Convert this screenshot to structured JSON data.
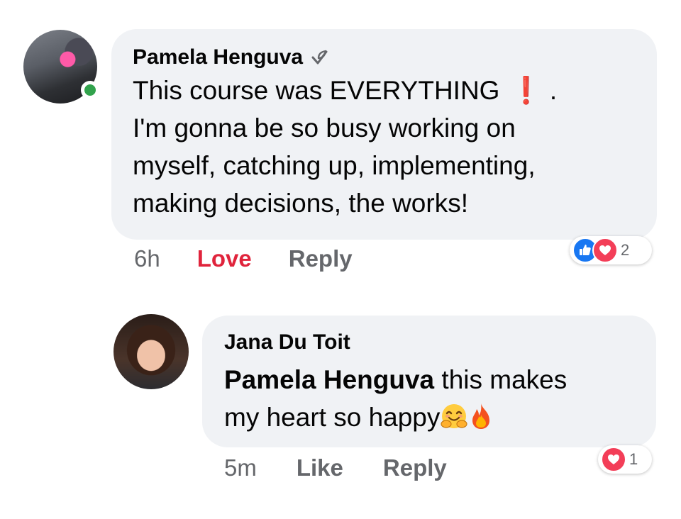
{
  "comments": [
    {
      "author": "Pamela Henguva",
      "lines": [
        "This course was EVERYTHING",
        "I'm gonna be so busy working on",
        "myself, catching up, implementing,",
        "making decisions, the works!"
      ],
      "exclaim": "❗",
      "dot": ".",
      "time": "6h",
      "reaction_action": "Love",
      "reply_label": "Reply",
      "reaction_count": "2",
      "reactions": [
        "like",
        "love"
      ],
      "online": true
    },
    {
      "author": "Jana Du Toit",
      "mention": "Pamela Henguva",
      "text_after_mention": " this makes",
      "line2": "my heart so happy",
      "emojis": [
        "hugging-face",
        "fire"
      ],
      "time": "5m",
      "reaction_action": "Like",
      "reply_label": "Reply",
      "reaction_count": "1",
      "reactions": [
        "love"
      ]
    }
  ],
  "colors": {
    "bubble": "#f0f2f5",
    "meta_text": "#65676b",
    "love_red": "#e0243c",
    "like_blue": "#1877f2",
    "online_green": "#31a24c"
  }
}
